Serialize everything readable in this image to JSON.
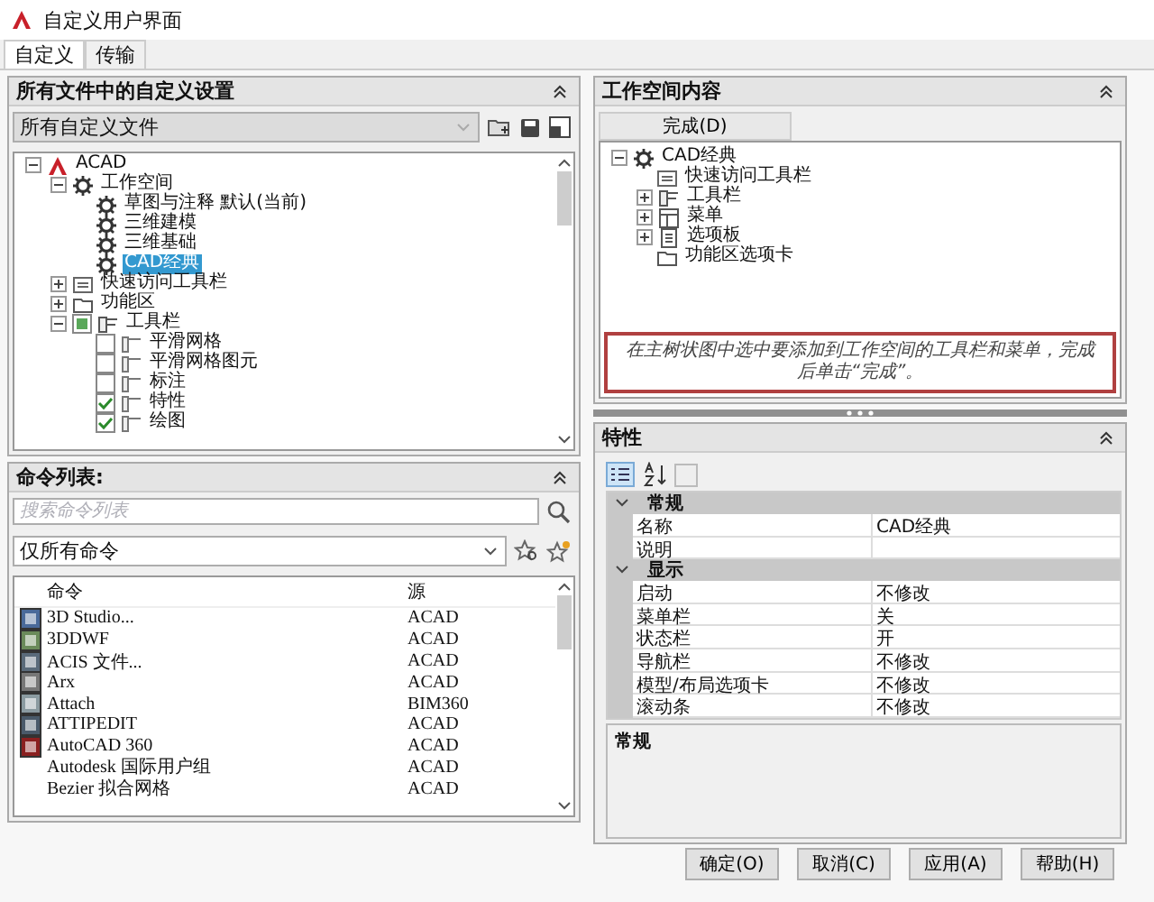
{
  "window": {
    "title": "自定义用户界面"
  },
  "tabs": [
    {
      "label": "自定义",
      "selected": true
    },
    {
      "label": "传输",
      "selected": false
    }
  ],
  "customizations_panel": {
    "title": "所有文件中的自定义设置",
    "file_select": "所有自定义文件",
    "tree": [
      {
        "label": "ACAD",
        "kind": "app",
        "expanded": true,
        "selected": false,
        "children": [
          {
            "label": "工作空间",
            "kind": "workspaces",
            "expanded": true,
            "selected": false,
            "children": [
              {
                "label": "草图与注释 默认(当前)",
                "kind": "workspace",
                "selected": false
              },
              {
                "label": "三维建模",
                "kind": "workspace",
                "selected": false
              },
              {
                "label": "三维基础",
                "kind": "workspace",
                "selected": false
              },
              {
                "label": "CAD经典",
                "kind": "workspace",
                "selected": true
              }
            ]
          },
          {
            "label": "快速访问工具栏",
            "kind": "quickaccess",
            "expanded": false,
            "selected": false
          },
          {
            "label": "功能区",
            "kind": "ribbon",
            "expanded": false,
            "selected": false
          },
          {
            "label": "工具栏",
            "kind": "toolbars",
            "expanded": true,
            "partially_checked": true,
            "selected": false,
            "children": [
              {
                "label": "平滑网格",
                "kind": "toolbar",
                "checked": false,
                "selected": false
              },
              {
                "label": "平滑网格图元",
                "kind": "toolbar",
                "checked": false,
                "selected": false
              },
              {
                "label": "标注",
                "kind": "toolbar",
                "checked": false,
                "selected": false
              },
              {
                "label": "特性",
                "kind": "toolbar",
                "checked": true,
                "selected": false
              },
              {
                "label": "绘图",
                "kind": "toolbar",
                "checked": true,
                "selected": false
              }
            ]
          }
        ]
      }
    ]
  },
  "command_panel": {
    "title": "命令列表:",
    "search": {
      "placeholder": "搜索命令列表"
    },
    "filter": "仅所有命令",
    "columns": [
      "命令",
      "源"
    ],
    "rows": [
      {
        "name": "3D Studio...",
        "source": "ACAD",
        "icon": true
      },
      {
        "name": "3DDWF",
        "source": "ACAD",
        "icon": true
      },
      {
        "name": "ACIS 文件...",
        "source": "ACAD",
        "icon": true
      },
      {
        "name": "Arx",
        "source": "ACAD",
        "icon": true
      },
      {
        "name": "Attach",
        "source": "BIM360",
        "icon": true
      },
      {
        "name": "ATTIPEDIT",
        "source": "ACAD",
        "icon": true
      },
      {
        "name": "AutoCAD 360",
        "source": "ACAD",
        "icon": true
      },
      {
        "name": "Autodesk 国际用户组",
        "source": "ACAD",
        "icon": false
      },
      {
        "name": "Bezier 拟合网格",
        "source": "ACAD",
        "icon": false
      }
    ]
  },
  "workspace_panel": {
    "title": "工作空间内容",
    "done_button": "完成(D)",
    "tree": [
      {
        "label": "CAD经典",
        "kind": "workspace",
        "expanded": true,
        "children": [
          {
            "label": "快速访问工具栏",
            "kind": "quickaccess"
          },
          {
            "label": "工具栏",
            "kind": "toolbars",
            "expanded": false
          },
          {
            "label": "菜单",
            "kind": "menu",
            "expanded": false
          },
          {
            "label": "选项板",
            "kind": "palette",
            "expanded": false
          },
          {
            "label": "功能区选项卡",
            "kind": "ribbon"
          }
        ]
      }
    ],
    "hint": "在主树状图中选中要添加到工作空间的工具栏和菜单，完成后单击“完成”。"
  },
  "properties_panel": {
    "title": "特性",
    "categories": [
      {
        "name": "常规",
        "expanded": true,
        "rows": [
          {
            "name": "名称",
            "value": "CAD经典"
          },
          {
            "name": "说明"
          }
        ]
      },
      {
        "name": "显示",
        "expanded": true,
        "rows": [
          {
            "name": "启动",
            "value": "不修改"
          },
          {
            "name": "菜单栏",
            "value": "关"
          },
          {
            "name": "状态栏",
            "value": "开"
          },
          {
            "name": "导航栏",
            "value": "不修改"
          },
          {
            "name": "模型/布局选项卡",
            "value": "不修改"
          },
          {
            "name": "滚动条",
            "value": "不修改"
          }
        ]
      }
    ],
    "description_title": "常规"
  },
  "buttons": [
    "确定(O)",
    "取消(C)",
    "应用(A)",
    "帮助(H)"
  ]
}
